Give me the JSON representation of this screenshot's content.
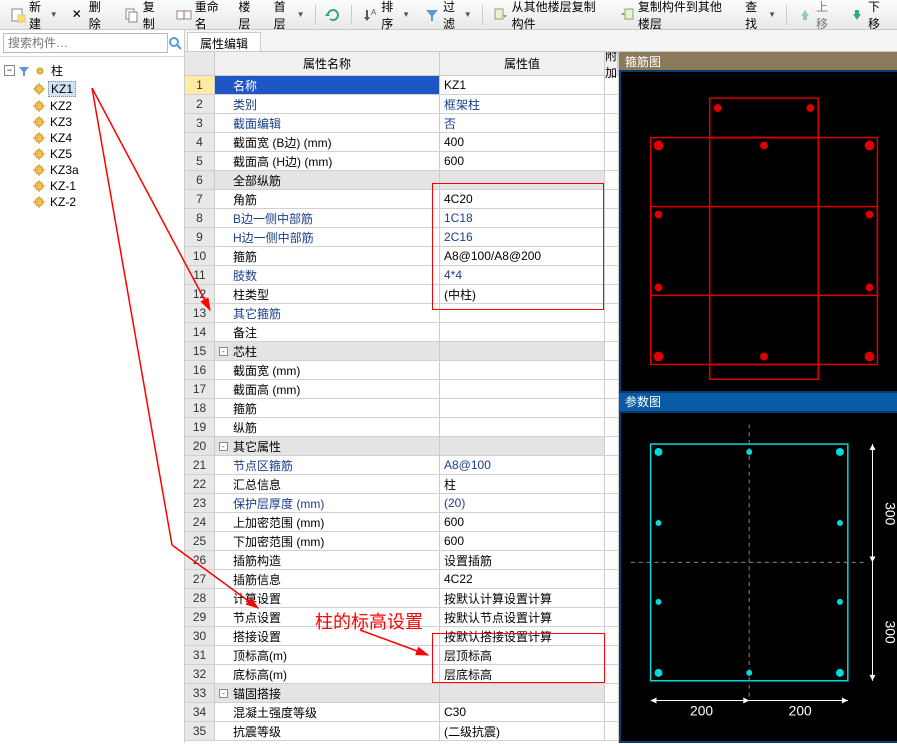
{
  "toolbar": {
    "new": "新建",
    "delete": "删除",
    "copy": "复制",
    "rename": "重命名",
    "floor": "楼层",
    "first_floor": "首层",
    "sort": "排序",
    "filter": "过滤",
    "copy_from_other": "从其他楼层复制构件",
    "copy_to_other": "复制构件到其他楼层",
    "search": "查找",
    "move_up": "上移",
    "move_down": "下移"
  },
  "search": {
    "placeholder": "搜索构件…"
  },
  "tree": {
    "root": "柱",
    "items": [
      "KZ1",
      "KZ2",
      "KZ3",
      "KZ4",
      "KZ5",
      "KZ3a",
      "KZ-1",
      "KZ-2"
    ],
    "selected": "KZ1"
  },
  "tab": "属性编辑",
  "prop_headers": {
    "name": "属性名称",
    "value": "属性值",
    "extra": "附加"
  },
  "props": [
    {
      "n": "1",
      "name": "名称",
      "val": "KZ1",
      "sel": true
    },
    {
      "n": "2",
      "name": "类别",
      "val": "框架柱",
      "blue": true
    },
    {
      "n": "3",
      "name": "截面编辑",
      "val": "否",
      "blue": true
    },
    {
      "n": "4",
      "name": "截面宽 (B边) (mm)",
      "val": "400"
    },
    {
      "n": "5",
      "name": "截面高 (H边) (mm)",
      "val": "600"
    },
    {
      "n": "6",
      "name": "全部纵筋",
      "val": "",
      "gray": true
    },
    {
      "n": "7",
      "name": "角筋",
      "val": "4C20"
    },
    {
      "n": "8",
      "name": "B边一侧中部筋",
      "val": "1C18",
      "blue": true
    },
    {
      "n": "9",
      "name": "H边一侧中部筋",
      "val": "2C16",
      "blue": true
    },
    {
      "n": "10",
      "name": "箍筋",
      "val": "A8@100/A8@200"
    },
    {
      "n": "11",
      "name": "肢数",
      "val": "4*4",
      "blue": true
    },
    {
      "n": "12",
      "name": "柱类型",
      "val": "(中柱)"
    },
    {
      "n": "13",
      "name": "其它箍筋",
      "val": "",
      "blue": true
    },
    {
      "n": "14",
      "name": "备注",
      "val": ""
    },
    {
      "n": "15",
      "name": "芯柱",
      "val": "",
      "gray": true,
      "expand": "-"
    },
    {
      "n": "16",
      "name": "截面宽 (mm)",
      "val": ""
    },
    {
      "n": "17",
      "name": "截面高 (mm)",
      "val": ""
    },
    {
      "n": "18",
      "name": "箍筋",
      "val": ""
    },
    {
      "n": "19",
      "name": "纵筋",
      "val": ""
    },
    {
      "n": "20",
      "name": "其它属性",
      "val": "",
      "gray": true,
      "expand": "-"
    },
    {
      "n": "21",
      "name": "节点区箍筋",
      "val": "A8@100",
      "blue": true
    },
    {
      "n": "22",
      "name": "汇总信息",
      "val": "柱"
    },
    {
      "n": "23",
      "name": "保护层厚度 (mm)",
      "val": "(20)",
      "blue": true
    },
    {
      "n": "24",
      "name": "上加密范围 (mm)",
      "val": "600"
    },
    {
      "n": "25",
      "name": "下加密范围 (mm)",
      "val": "600"
    },
    {
      "n": "26",
      "name": "插筋构造",
      "val": "设置插筋"
    },
    {
      "n": "27",
      "name": "插筋信息",
      "val": "4C22"
    },
    {
      "n": "28",
      "name": "计算设置",
      "val": "按默认计算设置计算"
    },
    {
      "n": "29",
      "name": "节点设置",
      "val": "按默认节点设置计算"
    },
    {
      "n": "30",
      "name": "搭接设置",
      "val": "按默认搭接设置计算"
    },
    {
      "n": "31",
      "name": "顶标高(m)",
      "val": "层顶标高"
    },
    {
      "n": "32",
      "name": "底标高(m)",
      "val": "层底标高"
    },
    {
      "n": "33",
      "name": "锚固搭接",
      "val": "",
      "gray": true,
      "expand": "-"
    },
    {
      "n": "34",
      "name": "混凝土强度等级",
      "val": "C30"
    },
    {
      "n": "35",
      "name": "抗震等级",
      "val": "(二级抗震)"
    }
  ],
  "panels": {
    "top_title": "箍筋图",
    "bottom_title": "参数图",
    "dim_h": "200",
    "dim_v": "300"
  },
  "annotations": {
    "column_elevation": "柱的标高设置"
  }
}
